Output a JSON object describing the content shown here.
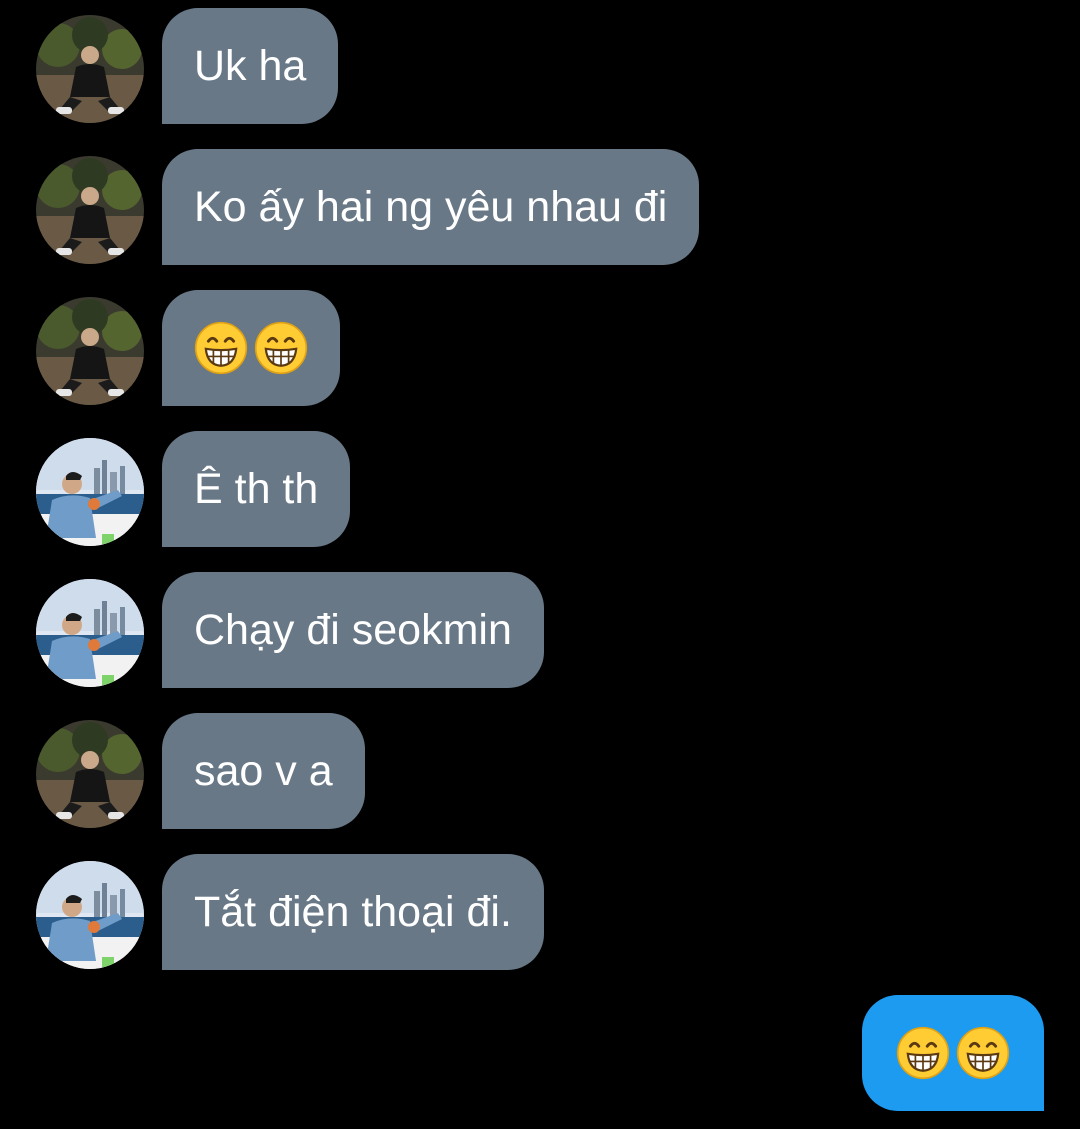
{
  "thread": {
    "messages": [
      {
        "direction": "incoming",
        "sender": "a",
        "kind": "text",
        "text": "Uk ha"
      },
      {
        "direction": "incoming",
        "sender": "a",
        "kind": "text",
        "text": "Ko ấy hai ng yêu nhau đi"
      },
      {
        "direction": "incoming",
        "sender": "a",
        "kind": "emoji",
        "emoji": [
          "grinning-face-emoji",
          "grinning-face-emoji"
        ]
      },
      {
        "direction": "incoming",
        "sender": "b",
        "kind": "text",
        "text": "Ê th th"
      },
      {
        "direction": "incoming",
        "sender": "b",
        "kind": "text",
        "text": "Chạy đi seokmin"
      },
      {
        "direction": "incoming",
        "sender": "a",
        "kind": "text",
        "text": "sao v a"
      },
      {
        "direction": "incoming",
        "sender": "b",
        "kind": "text",
        "text": "Tắt điện thoại đi."
      },
      {
        "direction": "outgoing",
        "kind": "emoji",
        "emoji": [
          "grinning-face-emoji",
          "grinning-face-emoji"
        ]
      }
    ]
  },
  "colors": {
    "background": "#000000",
    "incoming_bubble": "#687887",
    "outgoing_bubble": "#1d9bf0",
    "text": "#ffffff"
  }
}
